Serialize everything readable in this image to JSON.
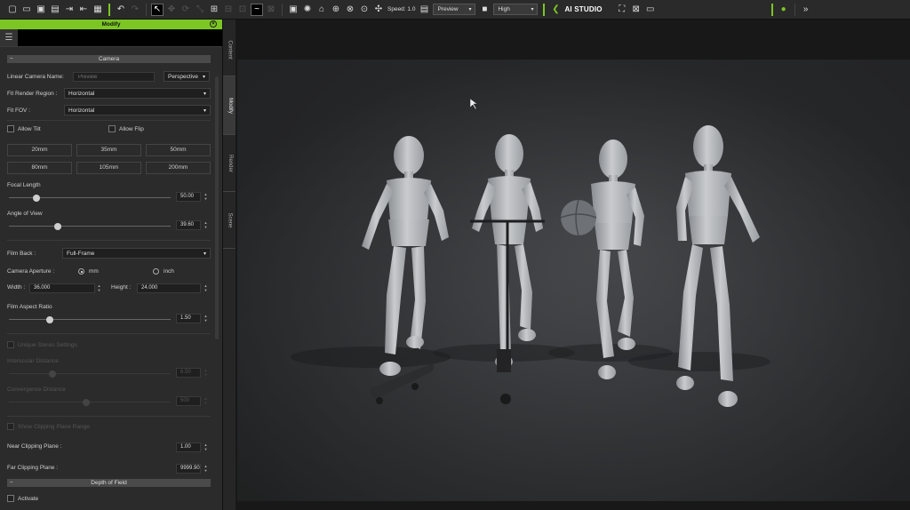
{
  "toolbar": {
    "speed_label": "Speed: 1.0",
    "preview_mode": "Preview",
    "quality": "High",
    "ai_studio": "AI STUDIO"
  },
  "panel": {
    "title": "Modify",
    "camera_section": "Camera",
    "linear_camera_name_label": "Linear Camera Name:",
    "linear_camera_name_placeholder": "Preview",
    "projection": "Perspective",
    "fit_render_region_label": "Fit Render Region :",
    "fit_render_region_value": "Horizontal",
    "fit_fov_label": "Fit FOV :",
    "fit_fov_value": "Horizontal",
    "allow_tilt": "Allow Tilt",
    "allow_flip": "Allow Flip",
    "lens_presets": [
      "20mm",
      "35mm",
      "50mm",
      "80mm",
      "105mm",
      "200mm"
    ],
    "focal_length_label": "Focal Length",
    "focal_length_value": "50.00",
    "focal_length_fraction": 0.17,
    "angle_of_view_label": "Angle of View",
    "angle_of_view_value": "39.60",
    "angle_of_view_fraction": 0.3,
    "film_back_label": "Film Back :",
    "film_back_value": "Full-Frame",
    "camera_aperture_label": "Camera Aperture :",
    "aperture_mm": "mm",
    "aperture_inch": "inch",
    "width_label": "Width :",
    "width_value": "36.000",
    "height_label": "Height :",
    "height_value": "24.000",
    "film_aspect_label": "Film Aspect Ratio",
    "film_aspect_value": "1.50",
    "film_aspect_fraction": 0.25,
    "stereo_settings": "Unique Stereo Settings",
    "interocular_label": "Interocular Distance",
    "interocular_value": "6.50",
    "interocular_fraction": 0.27,
    "convergence_label": "Convergence Distance",
    "convergence_value": "500",
    "convergence_fraction": 0.48,
    "show_clipping": "Show Clipping Plane Range",
    "near_clip_label": "Near Clipping Plane :",
    "near_clip_value": "1.00",
    "far_clip_label": "Far Clipping Plane :",
    "far_clip_value": "9999.90",
    "dof_section": "Depth of Field",
    "activate": "Activate"
  },
  "side_tabs": [
    "Content",
    "Modify",
    "Render",
    "Scene"
  ],
  "colors": {
    "accent": "#7cc624",
    "panel_bg": "#2b2b2b",
    "viewport_bg": "#3a3c3f"
  }
}
